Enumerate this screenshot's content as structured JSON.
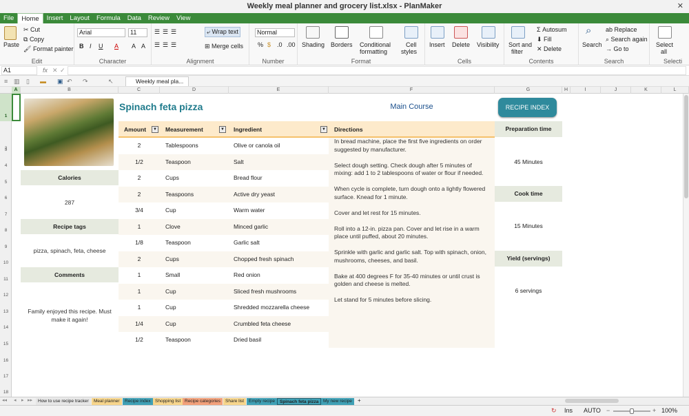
{
  "window": {
    "title": "Weekly meal planner and grocery list.xlsx - PlanMaker",
    "close": "✕"
  },
  "menu": [
    "File",
    "Home",
    "Insert",
    "Layout",
    "Formula",
    "Data",
    "Review",
    "View"
  ],
  "ribbon": {
    "edit": {
      "paste": "Paste",
      "cut": "Cut",
      "copy": "Copy",
      "format_painter": "Format painter",
      "label": "Edit"
    },
    "character": {
      "font": "Arial",
      "size": "11",
      "label": "Character"
    },
    "alignment": {
      "wrap": "Wrap text",
      "merge": "Merge cells",
      "label": "Alignment"
    },
    "number": {
      "format": "Normal",
      "label": "Number"
    },
    "format": {
      "shading": "Shading",
      "borders": "Borders",
      "conditional": "Conditional",
      "conditional2": "formatting",
      "cell_styles": "Cell",
      "cell_styles2": "styles",
      "label": "Format"
    },
    "cells": {
      "insert": "Insert",
      "delete": "Delete",
      "visibility": "Visibility",
      "label": "Cells"
    },
    "contents": {
      "sort": "Sort and",
      "sort2": "filter",
      "autosum": "Autosum",
      "fill": "Fill",
      "delete": "Delete",
      "label": "Contents"
    },
    "search": {
      "search": "Search",
      "replace": "Replace",
      "search_again": "Search again",
      "goto": "Go to",
      "label": "Search"
    },
    "select": {
      "select_all": "Select",
      "select_all2": "all",
      "label": "Selecti"
    }
  },
  "formula_bar": {
    "cell_ref": "A1",
    "fx": "fx",
    "value": ""
  },
  "doc_tab": "Weekly meal pla...",
  "columns": [
    "A",
    "B",
    "C",
    "D",
    "E",
    "F",
    "G",
    "H",
    "I",
    "J",
    "K",
    "L"
  ],
  "rows": [
    "1",
    "2",
    "3",
    "4",
    "5",
    "6",
    "7",
    "8",
    "9",
    "10",
    "11",
    "12",
    "13",
    "14",
    "15",
    "16",
    "17",
    "18"
  ],
  "recipe": {
    "title": "Spinach feta pizza",
    "course": "Main Course",
    "index_button": "RECIPE INDEX",
    "calories_label": "Calories",
    "calories": "287",
    "tags_label": "Recipe tags",
    "tags": "pizza, spinach, feta, cheese",
    "comments_label": "Comments",
    "comments": "Family enjoyed this recipe. Must make it again!",
    "prep_label": "Preparation time",
    "prep": "45 Minutes",
    "cook_label": "Cook time",
    "cook": "15 Minutes",
    "yield_label": "Yield (servings)",
    "yield": "6 servings",
    "headers": {
      "amount": "Amount",
      "measurement": "Measurement",
      "ingredient": "Ingredient",
      "directions": "Directions"
    },
    "ingredients": [
      {
        "amount": "2",
        "measurement": "Tablespoons",
        "ingredient": "Olive or canola oil"
      },
      {
        "amount": "1/2",
        "measurement": "Teaspoon",
        "ingredient": "Salt"
      },
      {
        "amount": "2",
        "measurement": "Cups",
        "ingredient": "Bread flour"
      },
      {
        "amount": "2",
        "measurement": "Teaspoons",
        "ingredient": "Active dry yeast"
      },
      {
        "amount": "3/4",
        "measurement": "Cup",
        "ingredient": "Warm water"
      },
      {
        "amount": "1",
        "measurement": "Clove",
        "ingredient": "Minced garlic"
      },
      {
        "amount": "1/8",
        "measurement": "Teaspoon",
        "ingredient": "Garlic salt"
      },
      {
        "amount": "2",
        "measurement": "Cups",
        "ingredient": "Chopped fresh spinach"
      },
      {
        "amount": "1",
        "measurement": "Small",
        "ingredient": "Red onion"
      },
      {
        "amount": "1",
        "measurement": "Cup",
        "ingredient": "Sliced fresh mushrooms"
      },
      {
        "amount": "1",
        "measurement": "Cup",
        "ingredient": "Shredded mozzarella cheese"
      },
      {
        "amount": "1/4",
        "measurement": "Cup",
        "ingredient": "Crumbled feta cheese"
      },
      {
        "amount": "1/2",
        "measurement": "Teaspoon",
        "ingredient": "Dried basil"
      }
    ],
    "directions": [
      "In bread machine, place the first five ingredients on order suggested by manufacturer.",
      "Select dough setting. Check dough after 5 minutes of mixing: add 1 to 2 tablespoons of water or flour if needed.",
      "When cycle is complete, turn dough onto a lightly flowered surface. Knead for 1 minute.",
      "Cover and let rest for 15 minutes.",
      "Roll into a 12-in. pizza pan. Cover and let rise in a warm place until puffed, about 20 minutes.",
      "Sprinkle with garlic and garlic salt. Top with spinach, onion, mushrooms, cheeses, and basil.",
      "Bake at 400 degrees F for 35-40 minutes or until crust is golden and cheese is melted.",
      "Let stand for 5 minutes before slicing."
    ]
  },
  "sheet_tabs": [
    {
      "label": "How to use recipe tracker",
      "color": "#e6e6e6"
    },
    {
      "label": "Meal planner",
      "color": "#f7d58b"
    },
    {
      "label": "Recipe index",
      "color": "#3fa0b5"
    },
    {
      "label": "Shopping list",
      "color": "#f7d58b"
    },
    {
      "label": "Recipe categories",
      "color": "#f2a07a"
    },
    {
      "label": "Share list",
      "color": "#f7d58b"
    },
    {
      "label": "Empty recipe",
      "color": "#3fa0b5"
    },
    {
      "label": "Spinach feta pizza",
      "color": "#3fa0b5"
    },
    {
      "label": "My new recipe",
      "color": "#3fa0b5"
    }
  ],
  "status": {
    "mode": "Ins",
    "calc": "AUTO",
    "zoom": "100%"
  },
  "colors": {
    "accent": "#3b8a3a",
    "title": "#1f7b8c",
    "button": "#2f8a9c",
    "label_bg": "#e6eadf",
    "header_bg": "#fdeacb"
  }
}
